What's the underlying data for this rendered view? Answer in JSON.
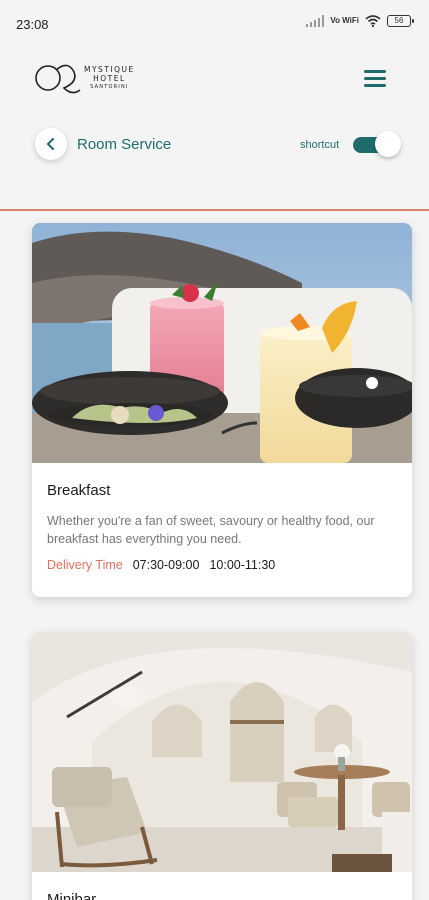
{
  "status_bar": {
    "time": "23:08",
    "network": "Vo WiFi",
    "battery": "56"
  },
  "header": {
    "logo_line1": "MYSTIQUE",
    "logo_line2": "HOTEL",
    "logo_line3": "SANTORINI",
    "title": "Room Service",
    "shortcut_label": "shortcut",
    "shortcut_on": true
  },
  "colors": {
    "accent": "#1f6b6b",
    "highlight": "#d9735e"
  },
  "icons": [
    "signal-icon",
    "wifi-icon",
    "battery-icon",
    "menu-icon",
    "back-chevron-icon"
  ],
  "cards": [
    {
      "name": "Breakfast",
      "description": "Whether you're a fan of sweet, savoury or healthy food, our breakfast has everything you need.",
      "delivery_label": "Delivery Time",
      "slots": [
        "07:30-09:00",
        "10:00-11:30"
      ]
    },
    {
      "name": "Minibar"
    }
  ]
}
